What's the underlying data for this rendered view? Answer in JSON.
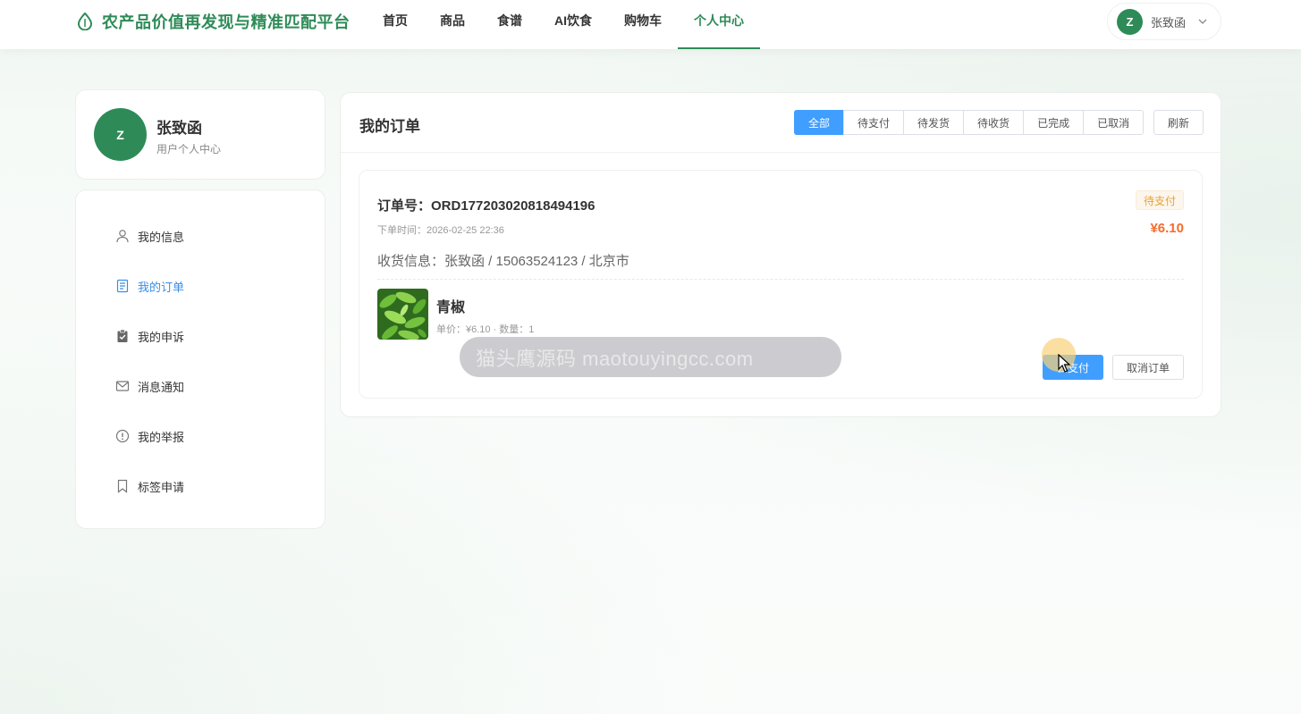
{
  "header": {
    "logo_text": "农产品价值再发现与精准匹配平台",
    "nav": [
      {
        "label": "首页"
      },
      {
        "label": "商品"
      },
      {
        "label": "食谱"
      },
      {
        "label": "AI饮食"
      },
      {
        "label": "购物车"
      },
      {
        "label": "个人中心",
        "active": true
      }
    ],
    "user": {
      "initial": "Z",
      "name": "张致函"
    }
  },
  "profile": {
    "initial": "Z",
    "name": "张致函",
    "subtitle": "用户个人中心"
  },
  "sidebar": {
    "items": [
      {
        "label": "我的信息",
        "icon": "user-icon"
      },
      {
        "label": "我的订单",
        "icon": "document-icon",
        "active": true
      },
      {
        "label": "我的申诉",
        "icon": "clipboard-icon"
      },
      {
        "label": "消息通知",
        "icon": "mail-icon"
      },
      {
        "label": "我的举报",
        "icon": "warning-icon"
      },
      {
        "label": "标签申请",
        "icon": "bookmark-icon"
      }
    ]
  },
  "orders": {
    "title": "我的订单",
    "filters": [
      "全部",
      "待支付",
      "待发货",
      "待收货",
      "已完成",
      "已取消"
    ],
    "active_filter": "全部",
    "refresh_label": "刷新",
    "items": [
      {
        "order_no": "订单号：ORD1772030208184941​96",
        "order_time": "下单时间：2026-02-25 22:36",
        "status": "待支付",
        "price": "¥6.10",
        "shipping": "收货信息：张致函 / 15063524123 / 北京市",
        "product": {
          "name": "青椒",
          "meta": "单价：¥6.10 · 数量：1"
        },
        "pay_label": "去支付",
        "cancel_label": "取消订单"
      }
    ]
  },
  "watermark": "猫头鹰源码 maotouyingcc.com",
  "colors": {
    "brand": "#2e8b57",
    "primary": "#409eff",
    "price": "#f56c2c",
    "pending": "#e6a23c"
  }
}
